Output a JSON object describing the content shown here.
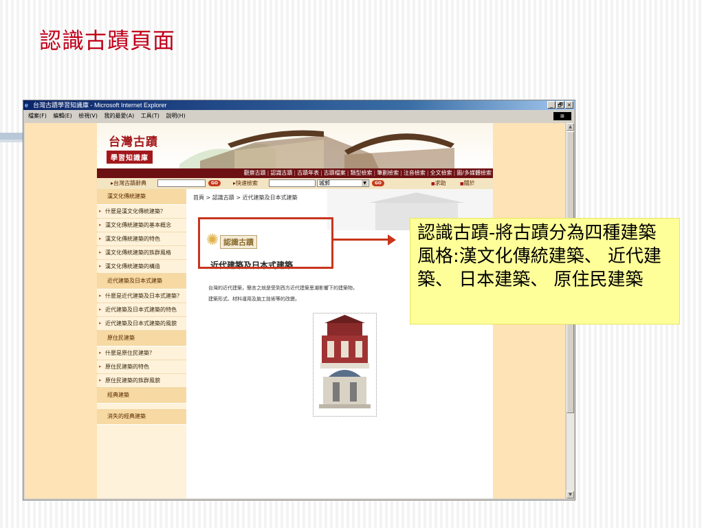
{
  "slide": {
    "title": "認識古蹟頁面"
  },
  "window": {
    "title": "台灣古蹟學習知識庫 - Microsoft Internet Explorer",
    "controls": [
      "_",
      "🗗",
      "×"
    ],
    "menu": [
      "檔案(F)",
      "編輯(E)",
      "檢視(V)",
      "我的最愛(A)",
      "工具(T)",
      "說明(H)"
    ]
  },
  "site": {
    "logo_line1": "台灣古蹟",
    "logo_line2": "學習知識庫",
    "nav": [
      "觀察古蹟",
      "認識古蹟",
      "古蹟年表",
      "古蹟檔案",
      "類型檢索",
      "筆劃檢索",
      "注音檢索",
      "全文檢索",
      "圖/多媒體檢索"
    ],
    "search": {
      "dictionary_label": "▸台灣古蹟辭典",
      "go": "GO",
      "quick_label": "▸快速檢索",
      "city_select": "城郭",
      "help": "求助",
      "about": "關於"
    }
  },
  "sidebar": {
    "sections": [
      {
        "heading": "漢文化傳統建築",
        "items": [
          "什麼是漢文化傳統建築？",
          "漢文化傳統建築的基本概念",
          "漢文化傳統建築的特色",
          "漢文化傳統建築的族群風格",
          "漢文化傳統建築的構造"
        ]
      },
      {
        "heading": "近代建築及日本式建築",
        "items": [
          "什麼是近代建築及日本式建築？",
          "近代建築及日本式建築的特色",
          "近代建築及日本式建築的風貌"
        ]
      },
      {
        "heading": "原住民建築",
        "items": [
          "什麼是原住民建築？",
          "原住民建築的特色",
          "原住民建築的族群風貌"
        ]
      },
      {
        "heading": "經典建築",
        "items": []
      },
      {
        "heading": "消失的經典建築",
        "items": []
      }
    ]
  },
  "main": {
    "breadcrumb": "首頁 > 認識古蹟 > 近代建築及日本式建築",
    "stamp_label": "認識古蹟",
    "article_title": "近代建築及日本式建築",
    "article_body": "台灣的近代建築，簡言之就是受到西方近代建築思潮影響下的建築物，",
    "article_body2": "建築形式、材料運用及施工技術等的改變。"
  },
  "callout": {
    "text": "認識古蹟-將古蹟分為四種建築風格:漢文化傳統建築、 近代建築、 日本建築、 原住民建築"
  },
  "colors": {
    "accent_red": "#c8341c",
    "callout_bg": "#ffff99",
    "nav_bg": "#6c1013",
    "page_bg": "#fde3b6"
  }
}
